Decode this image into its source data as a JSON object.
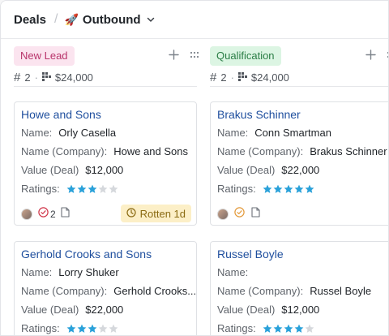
{
  "breadcrumb": {
    "root": "Deals",
    "separator": "/",
    "emoji": "🚀",
    "current": "Outbound"
  },
  "columns": [
    {
      "stage": "New Lead",
      "count_symbol": "#",
      "count": "2",
      "amount": "$24,000",
      "accent": "#b8336a",
      "cards": [
        {
          "title": "Howe and Sons",
          "name_label": "Name:",
          "name": "Orly Casella",
          "company_label": "Name (Company):",
          "company": "Howe and Sons",
          "value_label": "Value (Deal)",
          "value": "$12,000",
          "ratings_label": "Ratings:",
          "rating": 3,
          "task_count": "2",
          "rotten_label": "Rotten 1d"
        },
        {
          "title": "Gerhold Crooks and Sons",
          "name_label": "Name:",
          "name": "Lorry Shuker",
          "company_label": "Name (Company):",
          "company": "Gerhold Crooks...",
          "value_label": "Value (Deal)",
          "value": "$22,000",
          "ratings_label": "Ratings:",
          "rating": 3
        }
      ]
    },
    {
      "stage": "Qualification",
      "count_symbol": "#",
      "count": "2",
      "amount": "$24,000",
      "accent": "#2a7d45",
      "cards": [
        {
          "title": "Brakus Schinner",
          "name_label": "Name:",
          "name": "Conn Smartman",
          "company_label": "Name (Company):",
          "company": "Brakus Schinner",
          "value_label": "Value (Deal)",
          "value": "$22,000",
          "ratings_label": "Ratings:",
          "rating": 5
        },
        {
          "title": "Russel Boyle",
          "name_label": "Name:",
          "name": "",
          "company_label": "Name (Company):",
          "company": "Russel Boyle",
          "value_label": "Value (Deal)",
          "value": "$12,000",
          "ratings_label": "Ratings:",
          "rating": 4
        }
      ]
    }
  ],
  "colors": {
    "star_on": "#2aa1d9",
    "star_off": "#d5d8dc",
    "title_link": "#1f4f9e",
    "rotten_bg": "#fcefc7"
  }
}
